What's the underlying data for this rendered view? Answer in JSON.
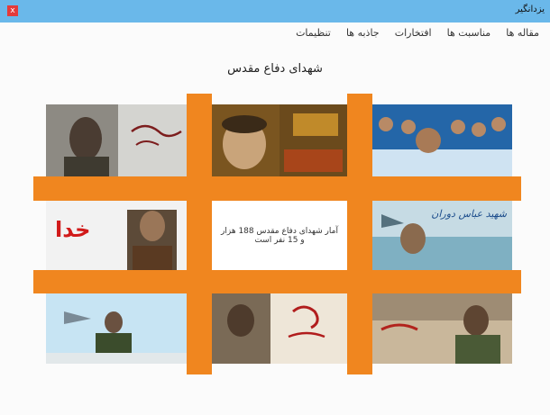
{
  "window": {
    "title": "یزدانگیر",
    "close_label": "x"
  },
  "menu": {
    "items": [
      {
        "label": "مقاله ها"
      },
      {
        "label": "مناسبت ها"
      },
      {
        "label": "افتخارات"
      },
      {
        "label": "جاذبه ها"
      },
      {
        "label": "تنظیمات"
      }
    ]
  },
  "page": {
    "title": "شهدای دفاع مقدس"
  },
  "tiles": [
    {
      "name": "martyr-photo-1",
      "overlay_text": ""
    },
    {
      "name": "martyr-photo-2",
      "overlay_text": ""
    },
    {
      "name": "martyr-photo-3",
      "overlay_text": ""
    },
    {
      "name": "martyr-photo-4",
      "overlay_text": "خدا"
    },
    {
      "name": "stats-card",
      "overlay_text": "آمار شهدای دفاع مقدس 188 هزار و 15 نفر است"
    },
    {
      "name": "martyr-photo-6",
      "overlay_text": "شهید عباس دوران"
    },
    {
      "name": "martyr-photo-7",
      "overlay_text": ""
    },
    {
      "name": "martyr-photo-8",
      "overlay_text": ""
    },
    {
      "name": "martyr-photo-9",
      "overlay_text": ""
    }
  ],
  "colors": {
    "accent": "#f0861f",
    "titlebar": "#6ab8ea",
    "close": "#e33b3b"
  }
}
